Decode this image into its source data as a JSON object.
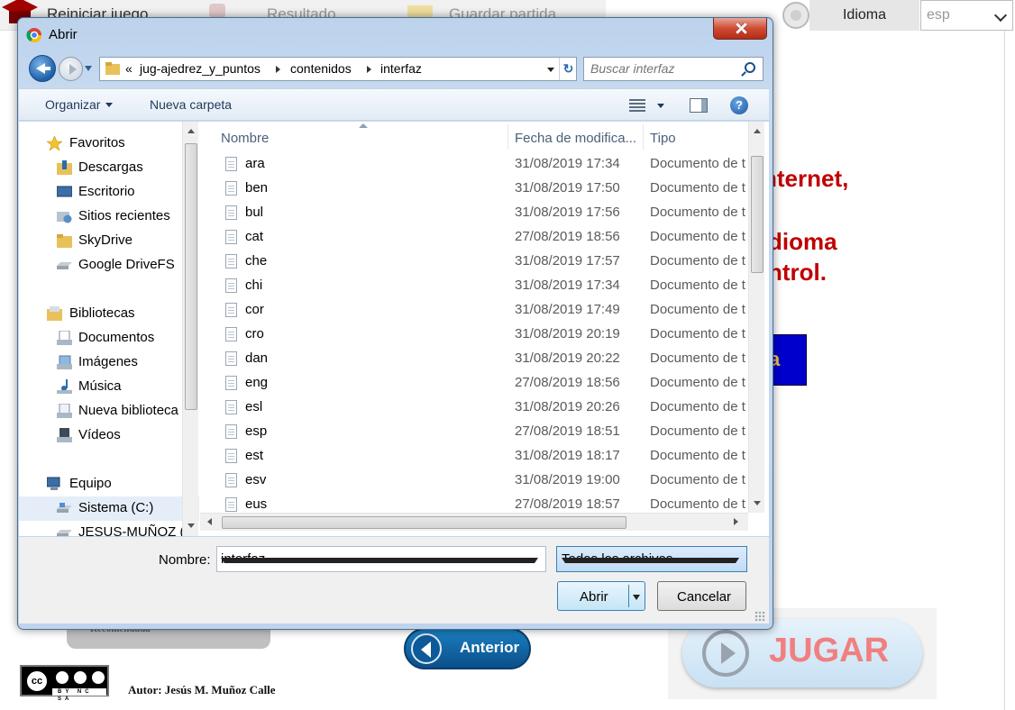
{
  "background": {
    "topbar": {
      "reset_label": "Reiniciar juego",
      "result_label": "Resultado",
      "save_label": "Guardar partida"
    },
    "language": {
      "label": "Idioma",
      "selected": "esp"
    },
    "red_text": [
      "nternet,",
      "dioma",
      "ntrol."
    ],
    "blue_button_fragment": "a",
    "gray_tab_text": "Recomendada",
    "anterior_label": "Anterior",
    "jugar_label": "JUGAR",
    "license": {
      "cc_text": "cc",
      "bar_text": "BY NC SA"
    },
    "author": "Autor: Jesús M. Muñoz Calle"
  },
  "dialog": {
    "title": "Abrir",
    "breadcrumb": [
      "«",
      "jug-ajedrez_y_puntos",
      "contenidos",
      "interfaz"
    ],
    "search_placeholder": "Buscar interfaz",
    "toolbar": {
      "organize_label": "Organizar",
      "new_folder_label": "Nueva carpeta"
    },
    "nav": {
      "favorites": {
        "label": "Favoritos",
        "items": [
          "Descargas",
          "Escritorio",
          "Sitios recientes",
          "SkyDrive",
          "Google DriveFS"
        ]
      },
      "libraries": {
        "label": "Bibliotecas",
        "items": [
          "Documentos",
          "Imágenes",
          "Música",
          "Nueva biblioteca",
          "Vídeos"
        ]
      },
      "computer": {
        "label": "Equipo",
        "items": [
          "Sistema (C:)",
          "JESUS-MUÑOZ (F"
        ]
      }
    },
    "columns": {
      "name": "Nombre",
      "date": "Fecha de modifica...",
      "type": "Tipo"
    },
    "files": [
      {
        "name": "ara",
        "date": "31/08/2019 17:34",
        "type": "Documento de t"
      },
      {
        "name": "ben",
        "date": "31/08/2019 17:50",
        "type": "Documento de t"
      },
      {
        "name": "bul",
        "date": "31/08/2019 17:56",
        "type": "Documento de t"
      },
      {
        "name": "cat",
        "date": "27/08/2019 18:56",
        "type": "Documento de t"
      },
      {
        "name": "che",
        "date": "31/08/2019 17:57",
        "type": "Documento de t"
      },
      {
        "name": "chi",
        "date": "31/08/2019 17:34",
        "type": "Documento de t"
      },
      {
        "name": "cor",
        "date": "31/08/2019 17:49",
        "type": "Documento de t"
      },
      {
        "name": "cro",
        "date": "31/08/2019 20:19",
        "type": "Documento de t"
      },
      {
        "name": "dan",
        "date": "31/08/2019 20:22",
        "type": "Documento de t"
      },
      {
        "name": "eng",
        "date": "27/08/2019 18:56",
        "type": "Documento de t"
      },
      {
        "name": "esl",
        "date": "31/08/2019 20:26",
        "type": "Documento de t"
      },
      {
        "name": "esp",
        "date": "27/08/2019 18:51",
        "type": "Documento de t"
      },
      {
        "name": "est",
        "date": "31/08/2019 18:17",
        "type": "Documento de t"
      },
      {
        "name": "esv",
        "date": "31/08/2019 19:00",
        "type": "Documento de t"
      },
      {
        "name": "eus",
        "date": "27/08/2019 18:57",
        "type": "Documento de t"
      }
    ],
    "filename_label": "Nombre:",
    "filename_value": "interfaz",
    "filetype_value": "Todos los archivos",
    "open_label": "Abrir",
    "cancel_label": "Cancelar"
  },
  "colors": {
    "accent_red": "#c00000",
    "dialog_frame": "#bcd3ec",
    "close_red": "#cf4c35"
  }
}
